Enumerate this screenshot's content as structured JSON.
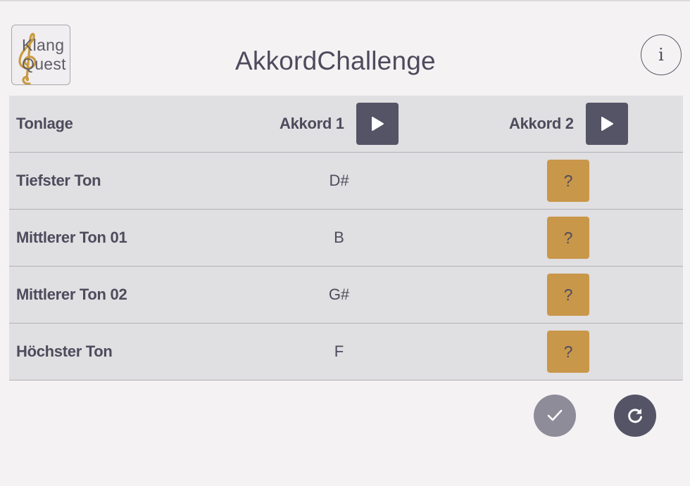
{
  "app": {
    "title": "AkkordChallenge",
    "logo_line1": "Klang",
    "logo_line2": "Quest",
    "info_label": "i"
  },
  "table": {
    "header": {
      "label": "Tonlage",
      "chord1": "Akkord 1",
      "chord2": "Akkord 2"
    },
    "rows": [
      {
        "label": "Tiefster Ton",
        "chord1": "D#",
        "chord2": "?"
      },
      {
        "label": "Mittlerer Ton 01",
        "chord1": "B",
        "chord2": "?"
      },
      {
        "label": "Mittlerer Ton 02",
        "chord1": "G#",
        "chord2": "?"
      },
      {
        "label": "Höchster Ton",
        "chord1": "F",
        "chord2": "?"
      }
    ]
  },
  "actions": {
    "check_icon": "check-icon",
    "reset_icon": "refresh-icon"
  },
  "colors": {
    "background": "#f4f2f3",
    "table_bg": "#e0dfe1",
    "primary_dark": "#555466",
    "accent_gold": "#c8974a",
    "disabled_gray": "#8e8c98",
    "text": "#4d4b5c"
  }
}
